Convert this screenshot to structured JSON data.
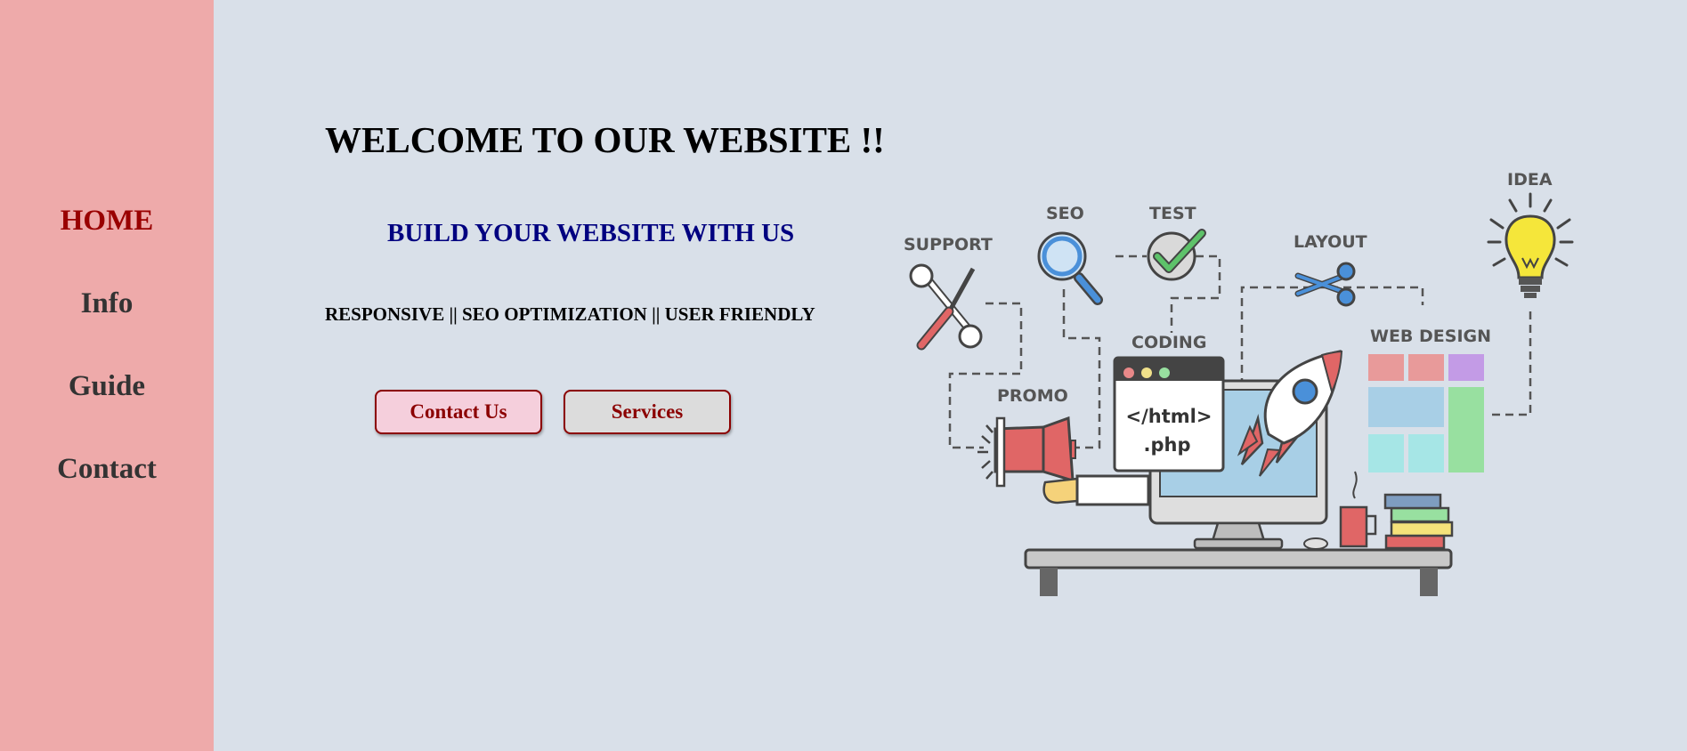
{
  "sidebar": {
    "items": [
      {
        "label": "HOME",
        "active": true
      },
      {
        "label": "Info",
        "active": false
      },
      {
        "label": "Guide",
        "active": false
      },
      {
        "label": "Contact",
        "active": false
      }
    ]
  },
  "hero": {
    "title": "WELCOME TO OUR WEBSITE !!",
    "subtitle": "BUILD YOUR WEBSITE WITH US",
    "features": "RESPONSIVE || SEO OPTIMIZATION || USER FRIENDLY",
    "contact_button": "Contact Us",
    "services_button": "Services"
  },
  "illustration": {
    "labels": {
      "support": "SUPPORT",
      "seo": "SEO",
      "test": "TEST",
      "layout": "LAYOUT",
      "idea": "IDEA",
      "coding": "CODING",
      "web_design": "WEB DESIGN",
      "promo": "PROMO"
    },
    "code_lines": [
      "</html>",
      ".php"
    ],
    "icons": [
      "tools-icon",
      "magnifier-icon",
      "checkmark-icon",
      "scissors-icon",
      "lightbulb-icon",
      "browser-window-icon",
      "rocket-icon",
      "megaphone-icon",
      "monitor-icon",
      "desk-icon",
      "mug-icon",
      "books-icon",
      "layout-grid-icon"
    ]
  },
  "colors": {
    "sidebar_bg": "#eeaaaa",
    "page_bg": "#d9e0e9",
    "active_nav": "#990000",
    "subtitle": "#000080",
    "button_text": "#8b0000"
  }
}
